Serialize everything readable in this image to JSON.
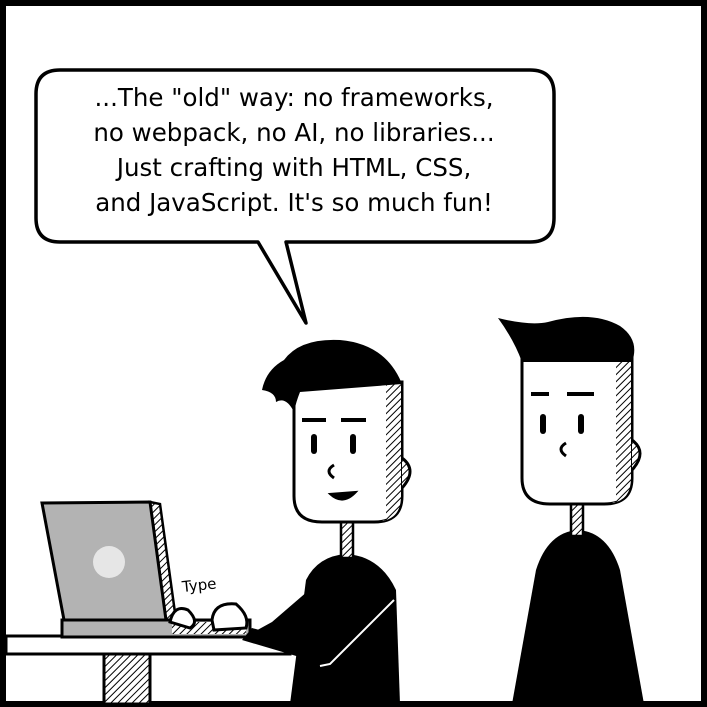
{
  "speech_bubble": {
    "lines": [
      "...The \"old\" way: no frameworks,",
      "no webpack, no AI, no libraries...",
      "Just crafting with HTML, CSS,",
      "and JavaScript. It's so much fun!"
    ]
  },
  "sound_effect": "Type",
  "colors": {
    "ink": "#000000",
    "paper": "#ffffff",
    "laptop_gray": "#b3b3b3",
    "laptop_glow": "#e6e6e6"
  }
}
